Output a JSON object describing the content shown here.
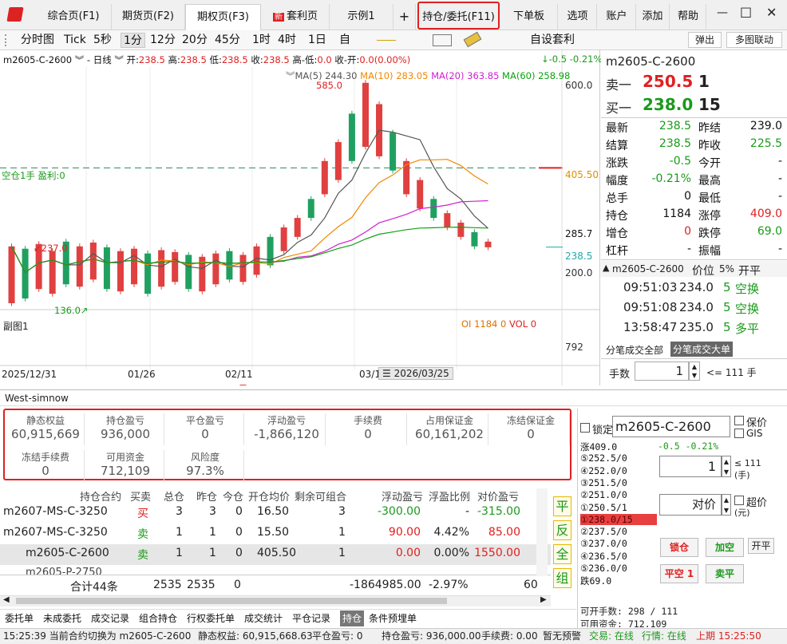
{
  "tabs": [
    {
      "label": "综合页(F1)"
    },
    {
      "label": "期货页(F2)"
    },
    {
      "label": "期权页(F3)"
    },
    {
      "label": "套利页",
      "badge": "新"
    },
    {
      "label": "示例1"
    },
    {
      "label": "+"
    },
    {
      "label": "持仓/委托(F11)"
    },
    {
      "label": "下单板(F12)"
    },
    {
      "label": "选项"
    },
    {
      "label": "账户"
    },
    {
      "label": "添加"
    },
    {
      "label": "帮助"
    }
  ],
  "window": {
    "min": "—",
    "max": "□",
    "close": "✕"
  },
  "toolbar": {
    "items": [
      "分时图",
      "Tick",
      "5秒",
      "1分",
      "12分",
      "20分",
      "45分",
      "1时",
      "4时",
      "1日",
      "自"
    ],
    "custom_arb": "自设套利",
    "popup": "弹出",
    "multi": "多图联动"
  },
  "chart": {
    "info": {
      "symbol": "m2605-C-2600",
      "period": "日线",
      "open_l": "开:",
      "open": "238.5",
      "high_l": "高:",
      "high": "238.5",
      "low_l": "低:",
      "low": "238.5",
      "close_l": "收:",
      "close": "238.5",
      "hl_l": "高-低:",
      "hl": "0.0",
      "chg_l": "收-开:",
      "chg": "0.0(",
      "chgp": "0.00%",
      "chg_end": ")",
      "right": "↓-0.5 -0.21%"
    },
    "ma": {
      "ma5": "MA(5) 244.30",
      "ma10": "MA(10) 283.05",
      "ma20": "MA(20) 363.85",
      "ma60": "MA(60) 258.98"
    },
    "y_labels": [
      "600.0",
      "405.50",
      "285.7",
      "238.5",
      "200.0",
      "792"
    ],
    "annot": {
      "hi": "585.0",
      "lo1": "↙237.0",
      "lo2": "136.0↗",
      "pos": "空仓1手 盈利:0"
    },
    "sub": {
      "label": "副图1",
      "oi": "OI 1184 0",
      "vol": "VOL 0"
    },
    "dates": [
      "2025/12/31",
      "01/26",
      "02/11",
      "03/1",
      "2026/03/25"
    ],
    "chart_data": {
      "type": "candlestick",
      "title": "",
      "price_ylim": [
        120,
        620
      ],
      "values": [
        [
          120,
          240
        ],
        [
          130,
          235
        ],
        [
          150,
          245
        ],
        [
          140,
          230
        ],
        [
          160,
          250
        ],
        [
          155,
          240
        ],
        [
          170,
          248
        ],
        [
          150,
          238
        ],
        [
          145,
          230
        ],
        [
          160,
          235
        ],
        [
          140,
          225
        ],
        [
          155,
          232
        ],
        [
          165,
          228
        ],
        [
          150,
          222
        ],
        [
          145,
          218
        ],
        [
          160,
          225
        ],
        [
          170,
          230
        ],
        [
          165,
          222
        ],
        [
          180,
          240
        ],
        [
          200,
          260
        ],
        [
          230,
          280
        ],
        [
          260,
          300
        ],
        [
          300,
          340
        ],
        [
          350,
          420
        ],
        [
          380,
          460
        ],
        [
          420,
          520
        ],
        [
          450,
          585
        ],
        [
          430,
          540
        ],
        [
          400,
          480
        ],
        [
          350,
          420
        ],
        [
          320,
          380
        ],
        [
          300,
          340
        ],
        [
          280,
          310
        ],
        [
          260,
          290
        ],
        [
          240,
          270
        ],
        [
          238,
          250
        ]
      ]
    }
  },
  "quote": {
    "symbol": "m2605-C-2600",
    "ask_l": "卖一",
    "ask": "250.5",
    "ask_v": "1",
    "bid_l": "买一",
    "bid": "238.0",
    "bid_v": "15",
    "rows": [
      [
        "最新",
        "238.5",
        "昨结",
        "239.0"
      ],
      [
        "结算",
        "238.5",
        "昨收",
        "225.5"
      ],
      [
        "涨跌",
        "-0.5",
        "今开",
        "-"
      ],
      [
        "幅度",
        "-0.21%",
        "最高",
        "-"
      ],
      [
        "总手",
        "0",
        "最低",
        "-"
      ],
      [
        "持仓",
        "1184",
        "涨停",
        "409.0"
      ],
      [
        "增仓",
        "0",
        "跌停",
        "69.0"
      ],
      [
        "杠杆",
        "-",
        "振幅",
        "-"
      ]
    ],
    "ticks_head": {
      "sym": "m2605-C-2600",
      "price": "价位",
      "pct": "5%",
      "kp": "开平"
    },
    "ticks": [
      [
        "09:51:03",
        "234.0",
        "5",
        "空换"
      ],
      [
        "09:51:08",
        "234.0",
        "5",
        "空换"
      ],
      [
        "13:58:47",
        "235.0",
        "5",
        "多平"
      ]
    ],
    "tick_tabs": [
      "分笔成交全部",
      "分笔成交大单"
    ],
    "lots_l": "手数",
    "lots": "1",
    "lots_max": "<= 111 手"
  },
  "account": {
    "name": "West-simnow",
    "fields": [
      [
        "静态权益",
        "60,915,669"
      ],
      [
        "持仓盈亏",
        "936,000"
      ],
      [
        "平仓盈亏",
        "0"
      ],
      [
        "浮动盈亏",
        "-1,866,120"
      ],
      [
        "手续费",
        "0"
      ],
      [
        "占用保证金",
        "60,161,202"
      ],
      [
        "冻结保证金",
        "0"
      ],
      [
        "冻结手续费",
        "0"
      ],
      [
        "可用资金",
        "712,109"
      ],
      [
        "风险度",
        "97.3%"
      ]
    ]
  },
  "positions": {
    "headers": [
      "持仓合约",
      "买卖",
      "总仓",
      "昨仓",
      "今仓",
      "开仓均价",
      "剩余可组合",
      "浮动盈亏",
      "浮盈比例",
      "对价盈亏"
    ],
    "rows": [
      [
        "m2607-MS-C-3250",
        "买",
        "3",
        "3",
        "0",
        "16.50",
        "3",
        "-300.00",
        "-",
        "-315.00"
      ],
      [
        "m2607-MS-C-3250",
        "卖",
        "1",
        "1",
        "0",
        "15.50",
        "1",
        "90.00",
        "4.42%",
        "85.00"
      ],
      [
        "m2605-C-2600",
        "卖",
        "1",
        "1",
        "0",
        "405.50",
        "1",
        "0.00",
        "0.00%",
        "1550.00"
      ]
    ],
    "total": {
      "label": "合计44条",
      "a": "2535",
      "b": "2535",
      "c": "0",
      "d": "-1864985.00",
      "e": "-2.97%",
      "f": "60"
    },
    "side_btns": [
      "平",
      "反",
      "全",
      "组"
    ]
  },
  "order": {
    "lock": "锁定",
    "symbol": "m2605-C-2600",
    "keep": "保价",
    "gis": "GIS",
    "book": [
      "涨409.0",
      "⑤252.5/0",
      "④252.0/0",
      "③251.5/0",
      "②251.0/0",
      "①250.5/1",
      "①238.0/15",
      "②237.5/0",
      "③237.0/0",
      "④236.5/0",
      "⑤236.0/0",
      "跌69.0"
    ],
    "chg": "-0.5  -0.21%",
    "qty": "1",
    "qty_max": "≤ 111",
    "qty_unit": "(手)",
    "price": "对价",
    "over": "超价",
    "price_unit": "(元)",
    "b1": "锁仓",
    "b2": "加空",
    "b3": "开平",
    "b4": "平空 1",
    "b5": "卖平",
    "avail": "可开手数: 298 / 111",
    "cash": "可用资金: 712,109"
  },
  "bottom_tabs": [
    "委托单",
    "未成委托",
    "成交记录",
    "组合持仓",
    "行权委托单",
    "成交统计",
    "平仓记录",
    "持仓",
    "条件预埋单"
  ],
  "status": {
    "text1": "15:25:39 当前合约切换为 m2605-C-2600",
    "s1": "静态权益: 60,915,668.63",
    "s2": "平仓盈亏: 0",
    "s3": "持仓盈亏: 936,000.00",
    "s4": "手续费: 0.00",
    "s5": "暂无预警",
    "s6": "交易: 在线",
    "s7": "行情: 在线",
    "s8": "上期 15:25:50"
  }
}
